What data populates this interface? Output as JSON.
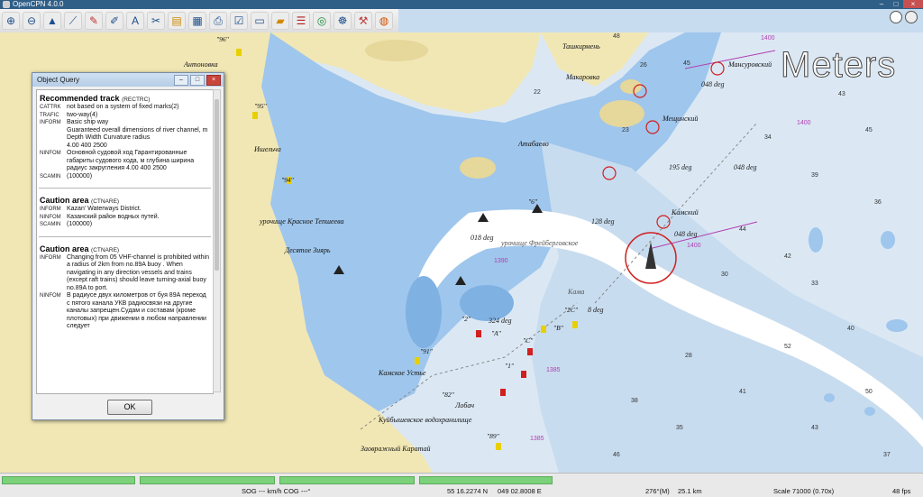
{
  "app": {
    "title": "OpenCPN 4.0.0"
  },
  "toolbar": {
    "icons": [
      "zoom-in-icon",
      "zoom-out-icon",
      "route-icon",
      "ship-icon",
      "chart-icon",
      "settings-icon",
      "text-icon",
      "mark-icon",
      "layers-icon",
      "ais-icon",
      "print-icon",
      "tasks-icon",
      "monitor-icon",
      "folder-icon",
      "mob-icon",
      "globe-icon",
      "tide-icon",
      "wrench-icon",
      "help-icon"
    ]
  },
  "map": {
    "scale_label": "Meters",
    "places": [
      "Антоновка",
      "Ташкирмень",
      "Макаровка",
      "Мансуровский",
      "Мещинский",
      "Ишельча",
      "Атабаево",
      "Камский",
      "урочище Красное Тепшеева",
      "Десятое Зиярь",
      "Камское Устье",
      "Куйбышевское водохранилище",
      "Заовражный Каратай",
      "урочище Фрейберговское",
      "Казанский",
      "Кама",
      "Лобач"
    ],
    "soundings": [
      "48",
      "45",
      "26",
      "23",
      "22",
      "43",
      "45",
      "34",
      "39",
      "36",
      "44",
      "42",
      "30",
      "33",
      "40",
      "52",
      "28",
      "41",
      "38",
      "35",
      "43",
      "37",
      "46",
      "50"
    ],
    "bearings": [
      "048 deg",
      "048 deg",
      "195 deg",
      "128 deg",
      "048 deg",
      "018 deg",
      "324 deg",
      "8 deg"
    ],
    "depth_contours": [
      "1400",
      "1400",
      "1390",
      "1385",
      "1385",
      "1400"
    ],
    "buoys": [
      "\"96\"",
      "\"95\"",
      "\"94\"",
      "\"6\"",
      "\"2\"",
      "\"2C\"",
      "\"91\"",
      "\"89\"",
      "\"82\"",
      "\"1\"",
      "\"A\"",
      "\"C\"",
      "\"B\""
    ]
  },
  "dialog": {
    "title": "Object Query",
    "sections": [
      {
        "name": "Recommended track",
        "code": "(RECTRC)",
        "rows": [
          {
            "k": "CATTRK",
            "v": "not based on a system of fixed marks(2)"
          },
          {
            "k": "TRAFIC",
            "v": "two-way(4)"
          },
          {
            "k": "INFORM",
            "v": "Basic ship way\nGuaranteed overall dimensions of river channel, m\nDepth Width Curvature radius\n4.00 400 2500"
          },
          {
            "k": "NINFOM",
            "v": "Основной судовой ход Гарантированные габариты судового хода, м глубина ширина радиус закругления 4.00 400 2500"
          },
          {
            "k": "SCAMIN",
            "v": "(100000)"
          }
        ]
      },
      {
        "name": "Caution area",
        "code": "(CTNARE)",
        "rows": [
          {
            "k": "INFORM",
            "v": "Kazan' Waterways District."
          },
          {
            "k": "NINFOM",
            "v": "Казанский район водных путей."
          },
          {
            "k": "SCAMIN",
            "v": "(100000)"
          }
        ]
      },
      {
        "name": "Caution area",
        "code": "(CTNARE)",
        "rows": [
          {
            "k": "INFORM",
            "v": "Changing from 05 VHF-channel is prohibited within a radius of 2km from no.89A buoy . When navigating in any direction vessels and trains (except raft trains) should leave turning-axial buoy no.89A to port."
          },
          {
            "k": "NINFOM",
            "v": "В радиусе двух километров от буя 89А переход с пятого канала УКВ радиосвязи на другие каналы запрещен.Судам и составам (кроме плотовых) при движении в любом направлении следует"
          }
        ]
      }
    ],
    "ok_label": "OK"
  },
  "status": {
    "sog_cog": "SOG --- km/h COG ---°",
    "lat": "55 16.2274 N",
    "lon": "049 02.8008 E",
    "bearing": "276°(M)",
    "dist": "25.1 km",
    "scale": "Scale 71000 (0.70x)",
    "fps": "48 fps"
  },
  "colors": {
    "land": "#f1e7b5",
    "shallow": "#9fc6ec",
    "mid": "#c8dcef",
    "deep": "#e8f1f8",
    "channel": "#ffffff",
    "chart_magenta": "#b03fb0"
  }
}
